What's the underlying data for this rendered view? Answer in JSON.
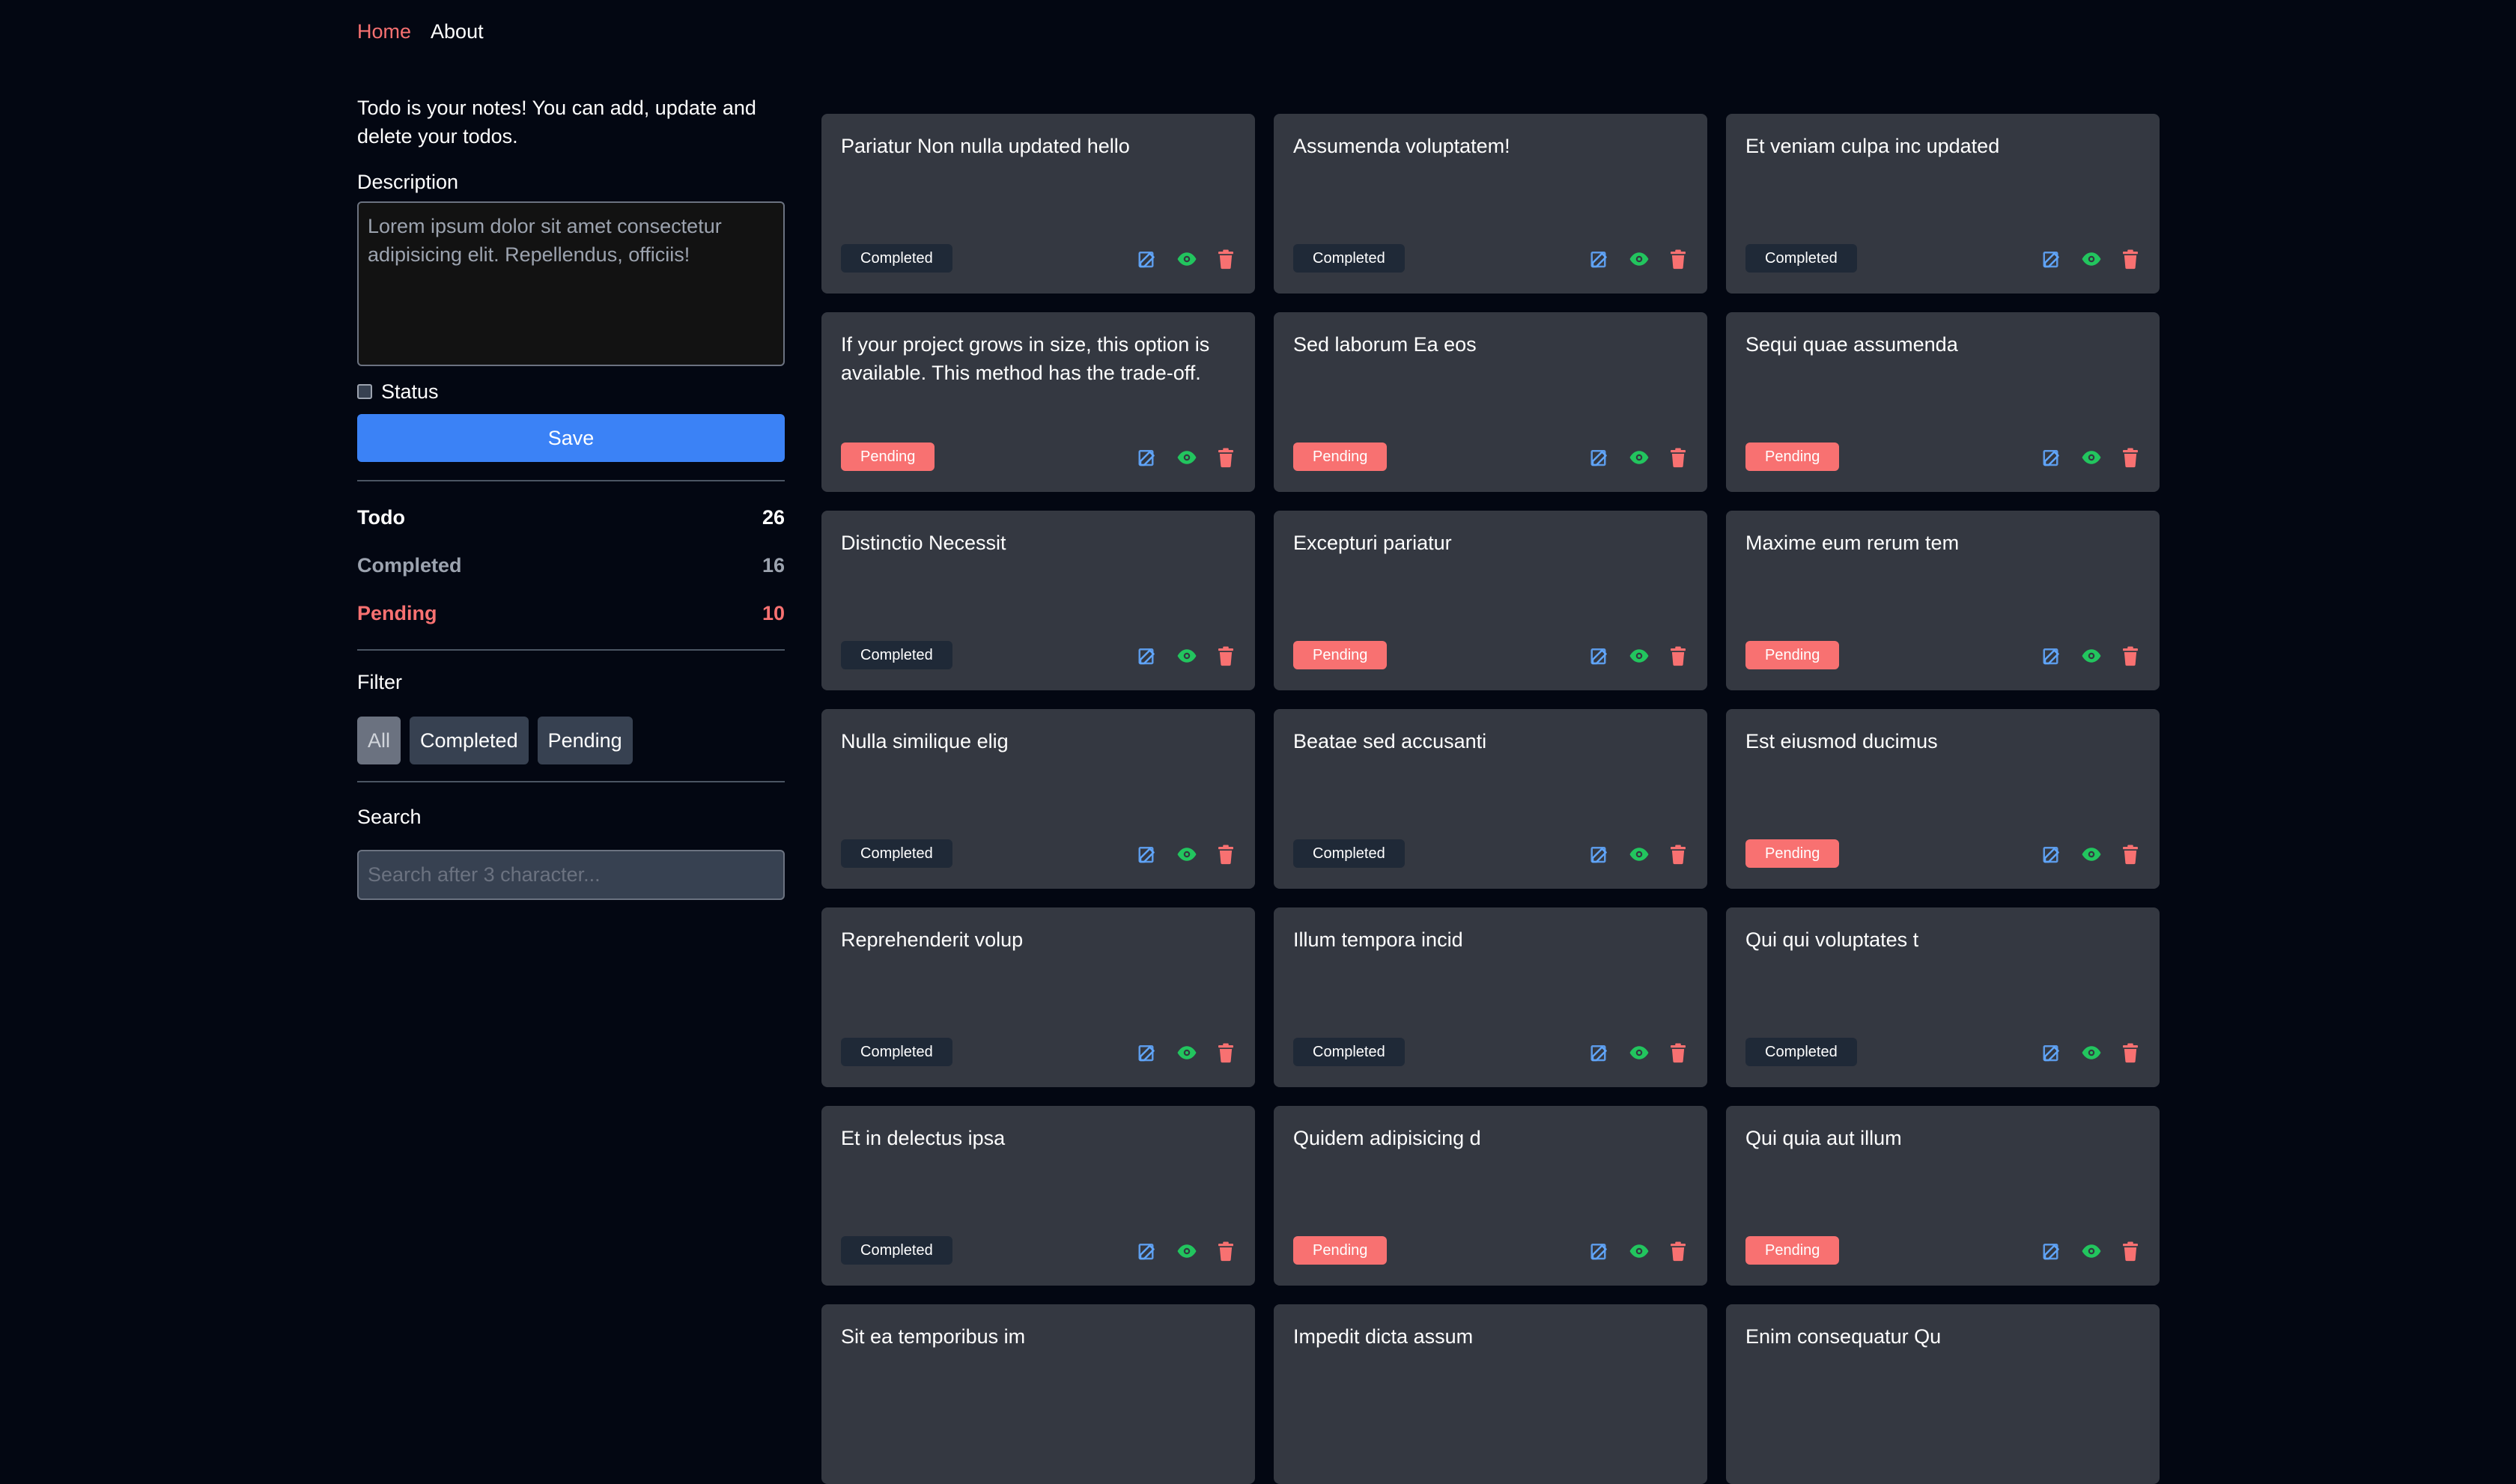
{
  "nav": {
    "home": "Home",
    "about": "About"
  },
  "sidebar": {
    "intro": "Todo is your notes! You can add, update and delete your todos.",
    "description_label": "Description",
    "description_value": "Lorem ipsum dolor sit amet consectetur adipisicing elit. Repellendus, officiis!",
    "status_label": "Status",
    "status_checked": false,
    "save_label": "Save",
    "stats": {
      "todo_label": "Todo",
      "todo_count": "26",
      "completed_label": "Completed",
      "completed_count": "16",
      "pending_label": "Pending",
      "pending_count": "10"
    },
    "filter": {
      "label": "Filter",
      "options": [
        "All",
        "Completed",
        "Pending"
      ],
      "active": "All"
    },
    "search": {
      "label": "Search",
      "placeholder": "Search after 3 character..."
    }
  },
  "colors": {
    "background": "#030712",
    "card": "#343841",
    "accent_blue": "#3b82f6",
    "pending_red": "#f87171",
    "view_green": "#22c55e",
    "edit_blue": "#60a5fa"
  },
  "icons": {
    "edit": "edit-icon",
    "view": "eye-icon",
    "delete": "trash-icon"
  },
  "todos": [
    {
      "title": "Pariatur Non nulla updated hello",
      "status": "Completed"
    },
    {
      "title": "Assumenda voluptatem!",
      "status": "Completed"
    },
    {
      "title": "Et veniam culpa inc updated",
      "status": "Completed"
    },
    {
      "title": "If your project grows in size, this option is available. This method has the trade-off.",
      "status": "Pending"
    },
    {
      "title": "Sed laborum Ea eos",
      "status": "Pending"
    },
    {
      "title": "Sequi quae assumenda",
      "status": "Pending"
    },
    {
      "title": "Distinctio Necessit",
      "status": "Completed"
    },
    {
      "title": "Excepturi pariatur",
      "status": "Pending"
    },
    {
      "title": "Maxime eum rerum tem",
      "status": "Pending"
    },
    {
      "title": "Nulla similique elig",
      "status": "Completed"
    },
    {
      "title": "Beatae sed accusanti",
      "status": "Completed"
    },
    {
      "title": "Est eiusmod ducimus",
      "status": "Pending"
    },
    {
      "title": "Reprehenderit volup",
      "status": "Completed"
    },
    {
      "title": "Illum tempora incid",
      "status": "Completed"
    },
    {
      "title": "Qui qui voluptates t",
      "status": "Completed"
    },
    {
      "title": "Et in delectus ipsa",
      "status": "Completed"
    },
    {
      "title": "Quidem adipisicing d",
      "status": "Pending"
    },
    {
      "title": "Qui quia aut illum",
      "status": "Pending"
    },
    {
      "title": "Sit ea temporibus im",
      "status": ""
    },
    {
      "title": "Impedit dicta assum",
      "status": ""
    },
    {
      "title": "Enim consequatur Qu",
      "status": ""
    }
  ]
}
